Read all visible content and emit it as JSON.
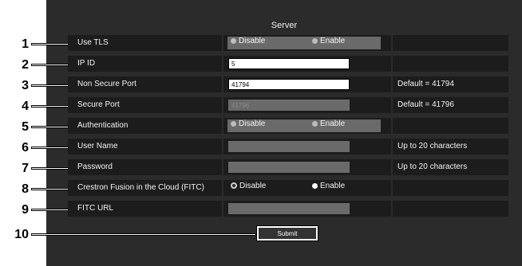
{
  "server_title": "Server",
  "callouts": [
    "1",
    "2",
    "3",
    "4",
    "5",
    "6",
    "7",
    "8",
    "9",
    "10"
  ],
  "rows": {
    "use_tls": {
      "label": "Use TLS",
      "option_disable": "Disable",
      "option_enable": "Enable"
    },
    "ip_id": {
      "label": "IP ID",
      "value": "5"
    },
    "non_secure_port": {
      "label": "Non Secure Port",
      "value": "41794",
      "hint": "Default = 41794"
    },
    "secure_port": {
      "label": "Secure Port",
      "value": "41796",
      "hint": "Default = 41796"
    },
    "authentication": {
      "label": "Authentication",
      "option_disable": "Disable",
      "option_enable": "Enable"
    },
    "user_name": {
      "label": "User Name",
      "value": "",
      "hint": "Up to 20 characters"
    },
    "password": {
      "label": "Password",
      "value": "",
      "hint": "Up to 20 characters"
    },
    "fitc": {
      "label": "Crestron Fusion in the Cloud (FITC)",
      "option_disable": "Disable",
      "option_enable": "Enable"
    },
    "fitc_url": {
      "label": "FITC URL",
      "value": ""
    }
  },
  "submit_label": "Submit"
}
